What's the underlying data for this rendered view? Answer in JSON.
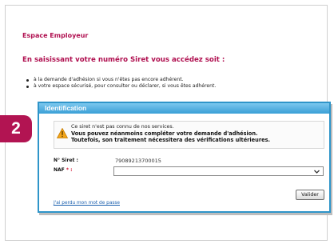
{
  "page": {
    "section_title": "Espace Employeur",
    "headline": "En saisissant votre numéro Siret vous accédez soit :",
    "bullets": [
      "à la demande d'adhésion si vous n'êtes pas encore adhérent.",
      "à votre espace sécurisé, pour consulter ou déclarer, si vous êtes adhérent."
    ]
  },
  "step_badge": "2",
  "dialog": {
    "title": "Identification",
    "alert": {
      "icon": "warning-triangle-icon",
      "line1": "Ce siret n'est pas connu de nos services.",
      "line2": "Vous pouvez néanmoins compléter votre demande d'adhésion.",
      "line3": "Toutefois, son traitement nécessitera des vérifications ultérieures."
    },
    "siret_label": "N° Siret :",
    "siret_value": "79089213700015",
    "naf_label": "NAF",
    "naf_required": " * :",
    "naf_selected": "",
    "submit_label": "Valider",
    "lost_password_link": "J'ai perdu mon mot de passe"
  },
  "colors": {
    "accent": "#b01050",
    "dialog_border": "#2f95c9",
    "link": "#1a5fae"
  }
}
